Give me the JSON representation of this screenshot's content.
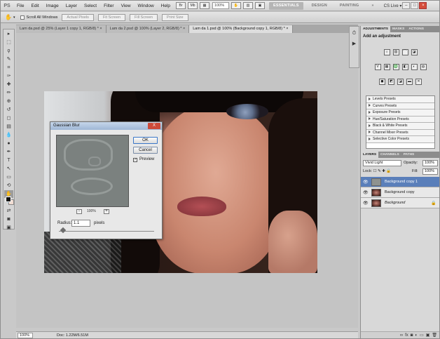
{
  "app": {
    "logo": "PS",
    "menus": [
      "File",
      "Edit",
      "Image",
      "Layer",
      "Select",
      "Filter",
      "View",
      "Window",
      "Help"
    ],
    "zoom": "100%",
    "workspaces": [
      {
        "label": "ESSENTIALS",
        "active": true
      },
      {
        "label": "DESIGN",
        "active": false
      },
      {
        "label": "PAINTING",
        "active": false
      }
    ],
    "more": "»",
    "cs_live": "CS Live ▾",
    "window_controls": [
      "–",
      "□",
      "×"
    ]
  },
  "options_bar": {
    "tool_icon": "hand-icon",
    "scroll_all_windows": "Scroll All Windows",
    "buttons": [
      "Actual Pixels",
      "Fit Screen",
      "Fill Screen",
      "Print Size"
    ]
  },
  "tabs": [
    {
      "label": "Lam da.psd @ 25% (Layer 1 copy 1, RGB/8) *",
      "close": "×",
      "active": false
    },
    {
      "label": "Lam da 2.psd @ 100% (Layer 2, RGB/8) *",
      "close": "×",
      "active": false
    },
    {
      "label": "Lam da 1.psd @ 100% (Background copy 1, RGB/8) *",
      "close": "×",
      "active": true
    }
  ],
  "tools": [
    "move-icon",
    "marquee-icon",
    "lasso-icon",
    "quick-select-icon",
    "crop-icon",
    "eyedropper-icon",
    "healing-icon",
    "brush-icon",
    "clone-stamp-icon",
    "history-brush-icon",
    "eraser-icon",
    "gradient-icon",
    "blur-icon",
    "dodge-icon",
    "pen-icon",
    "type-icon",
    "path-select-icon",
    "shape-icon",
    "3d-rotate-icon",
    "hand-icon",
    "zoom-icon",
    "swap-colors-icon",
    "quick-mask-icon",
    "screen-mode-icon"
  ],
  "tool_glyphs": [
    "▸",
    "⬚",
    "ϙ",
    "✎",
    "⌗",
    "✑",
    "✚",
    "✏",
    "⊕",
    "↺",
    "◻",
    "▤",
    "💧",
    "●",
    "✒",
    "T",
    "↖",
    "▭",
    "⟲",
    "✋",
    "🔍",
    "⇄",
    "◙",
    "▣"
  ],
  "dialog": {
    "title": "Gaussian Blur",
    "close": "X",
    "ok": "OK",
    "cancel": "Cancel",
    "preview_checked": "✓",
    "preview_label": "Preview",
    "zoom_out": "-",
    "zoom_level": "100%",
    "zoom_in": "+",
    "radius_label": "Radius:",
    "radius_value": "1.1",
    "radius_units": "pixels"
  },
  "status": {
    "zoom": "100%",
    "doc": "Doc: 1.22M/6.51M"
  },
  "panels": {
    "adjustments_tabs": [
      {
        "label": "ADJUSTMENTS",
        "active": true
      },
      {
        "label": "MASKS",
        "active": false
      },
      {
        "label": "ACTIONS",
        "active": false
      }
    ],
    "adjustments_title": "Add an adjustment",
    "adj_row1": [
      "☼",
      "▥",
      "⌒",
      "◪"
    ],
    "adj_row2": [
      "V",
      "▦",
      "♎",
      "◧",
      "◐",
      "◍"
    ],
    "adj_row3": [
      "◼",
      "◩",
      "◪",
      "▬",
      "✕"
    ],
    "presets": [
      "Levels Presets",
      "Curves Presets",
      "Exposure Presets",
      "Hue/Saturation Presets",
      "Black & White Presets",
      "Channel Mixer Presets",
      "Selective Color Presets"
    ],
    "layers_tabs": [
      {
        "label": "LAYERS",
        "active": true
      },
      {
        "label": "CHANNELS",
        "active": false
      },
      {
        "label": "PATHS",
        "active": false
      }
    ],
    "blend_mode": "Vivid Light",
    "opacity_label": "Opacity:",
    "opacity_value": "100%",
    "lock_label": "Lock: ☐ ✎ ✚ 🔒",
    "fill_label": "Fill:",
    "fill_value": "100%",
    "layers": [
      {
        "name": "Background copy 1",
        "selected": true,
        "eye": "👁",
        "lock": ""
      },
      {
        "name": "Background copy",
        "selected": false,
        "eye": "👁",
        "lock": ""
      },
      {
        "name": "Background",
        "selected": false,
        "eye": "👁",
        "lock": "🔒"
      }
    ],
    "layers_footer": [
      "∞",
      "fx",
      "◙",
      "◐",
      "▭",
      "▣",
      "🗑"
    ]
  }
}
